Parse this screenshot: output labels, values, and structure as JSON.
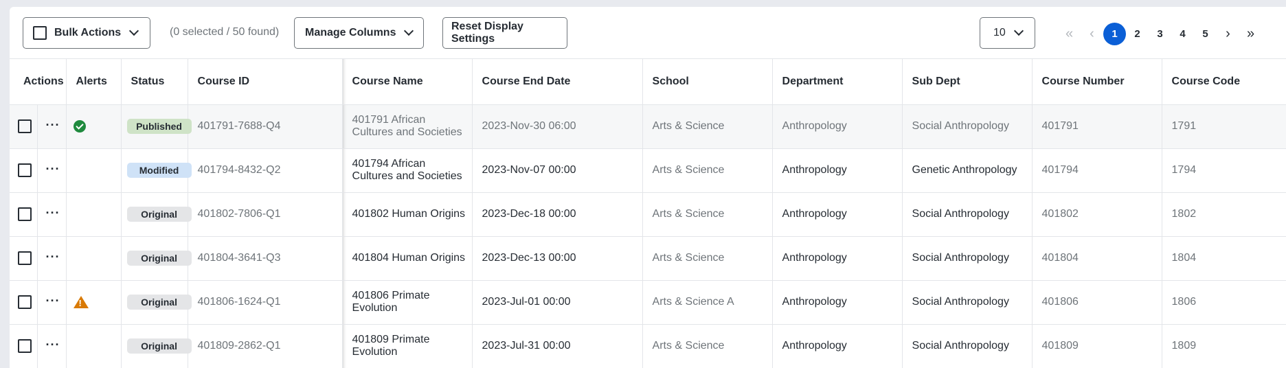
{
  "toolbar": {
    "bulk_actions_label": "Bulk Actions",
    "selection_count": "(0 selected / 50 found)",
    "manage_columns_label": "Manage Columns",
    "reset_label": "Reset Display Settings",
    "page_size": "10"
  },
  "pagination": {
    "first": "«",
    "prev": "‹",
    "pages": [
      "1",
      "2",
      "3",
      "4",
      "5"
    ],
    "active_page": "1",
    "next": "›",
    "last": "»"
  },
  "table": {
    "headers": [
      "Actions",
      "Alerts",
      "Status",
      "Course ID",
      "Course Name",
      "Course End Date",
      "School",
      "Department",
      "Sub Dept",
      "Course Number",
      "Course Code"
    ],
    "rows": [
      {
        "alert": "check-icon",
        "status": "Published",
        "course_id": "401791-7688-Q4",
        "course_name": "401791 African Cultures and Societies",
        "end_date": "2023-Nov-30 06:00",
        "school": "Arts & Science",
        "department": "Anthropology",
        "sub_dept": "Social Anthropology",
        "course_number": "401791",
        "course_code": "1791"
      },
      {
        "alert": "",
        "status": "Modified",
        "course_id": "401794-8432-Q2",
        "course_name": "401794 African Cultures and Societies",
        "end_date": "2023-Nov-07 00:00",
        "school": "Arts & Science",
        "department": "Anthropology",
        "sub_dept": "Genetic Anthropology",
        "course_number": "401794",
        "course_code": "1794"
      },
      {
        "alert": "",
        "status": "Original",
        "course_id": "401802-7806-Q1",
        "course_name": "401802 Human Origins",
        "end_date": "2023-Dec-18 00:00",
        "school": "Arts & Science",
        "department": "Anthropology",
        "sub_dept": "Social Anthropology",
        "course_number": "401802",
        "course_code": "1802"
      },
      {
        "alert": "",
        "status": "Original",
        "course_id": "401804-3641-Q3",
        "course_name": "401804 Human Origins",
        "end_date": "2023-Dec-13 00:00",
        "school": "Arts & Science",
        "department": "Anthropology",
        "sub_dept": "Social Anthropology",
        "course_number": "401804",
        "course_code": "1804"
      },
      {
        "alert": "warning-icon",
        "status": "Original",
        "course_id": "401806-1624-Q1",
        "course_name": "401806 Primate Evolution",
        "end_date": "2023-Jul-01 00:00",
        "school": "Arts & Science A",
        "department": "Anthropology",
        "sub_dept": "Social Anthropology",
        "course_number": "401806",
        "course_code": "1806"
      },
      {
        "alert": "",
        "status": "Original",
        "course_id": "401809-2862-Q1",
        "course_name": "401809 Primate Evolution",
        "end_date": "2023-Jul-31 00:00",
        "school": "Arts & Science",
        "department": "Anthropology",
        "sub_dept": "Social Anthropology",
        "course_number": "401809",
        "course_code": "1809"
      }
    ]
  },
  "colors": {
    "accent": "#0b5fd6",
    "published": "#cfe3c7",
    "modified": "#cfe2f7",
    "original": "#e4e5e7",
    "success_icon": "#1f8a3e",
    "warning_icon": "#d97a06"
  }
}
